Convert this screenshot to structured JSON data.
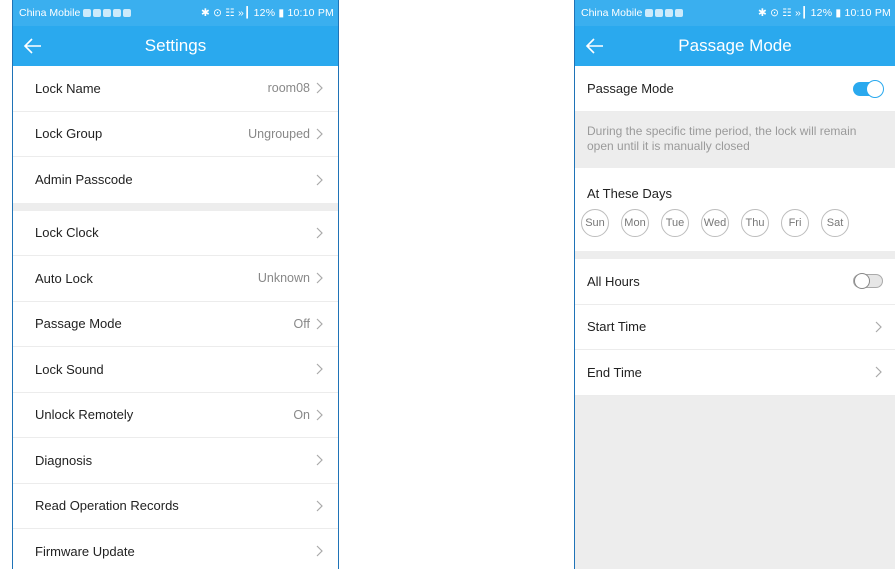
{
  "left_screen": {
    "status_bar": {
      "carrier": "China Mobile",
      "status_right": "✱ ⊙ ☷ »┃ 12% ▮ 10:10 PM"
    },
    "title": "Settings",
    "rows": [
      {
        "label": "Lock Name",
        "value": "room08"
      },
      {
        "label": "Lock Group",
        "value": "Ungrouped"
      },
      {
        "label": "Admin Passcode",
        "value": ""
      },
      {
        "label": "Lock Clock",
        "value": ""
      },
      {
        "label": "Auto Lock",
        "value": "Unknown"
      },
      {
        "label": "Passage Mode",
        "value": "Off"
      },
      {
        "label": "Lock Sound",
        "value": ""
      },
      {
        "label": "Unlock Remotely",
        "value": "On"
      },
      {
        "label": "Diagnosis",
        "value": ""
      },
      {
        "label": "Read Operation Records",
        "value": ""
      },
      {
        "label": "Firmware Update",
        "value": ""
      }
    ]
  },
  "right_screen": {
    "status_bar": {
      "carrier": "China Mobile",
      "status_right": "✱ ⊙ ☷ »┃ 12% ▮ 10:10 PM"
    },
    "title": "Passage Mode",
    "passage_mode": {
      "label": "Passage Mode",
      "enabled": true
    },
    "description": "During the specific time period, the lock will remain open until it is manually closed",
    "days_header": "At These Days",
    "days": [
      "Sun",
      "Mon",
      "Tue",
      "Wed",
      "Thu",
      "Fri",
      "Sat"
    ],
    "all_hours": {
      "label": "All Hours",
      "enabled": false
    },
    "start_time": "Start Time",
    "end_time": "End Time"
  },
  "colors": {
    "accent": "#2aa9ee",
    "background_grey": "#ededed",
    "frame": "#1f73b7"
  },
  "icons": {
    "back": "arrow-left-icon",
    "chevron": "chevron-right-icon",
    "toggle": "toggle-switch"
  }
}
